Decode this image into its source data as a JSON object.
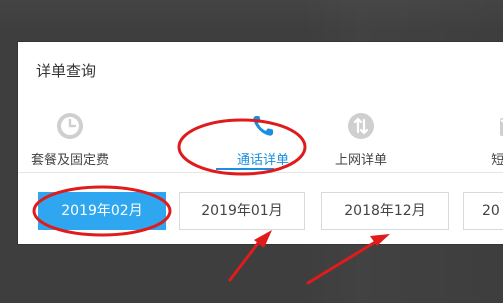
{
  "dialog": {
    "title": "详单查询"
  },
  "tabs": [
    {
      "label": "套餐及固定费",
      "icon": "clock-icon",
      "active": false
    },
    {
      "label": "通话详单",
      "icon": "phone-icon",
      "active": true
    },
    {
      "label": "上网详单",
      "icon": "data-transfer-icon",
      "active": false
    },
    {
      "label": "短信/彩",
      "icon": "envelope-icon",
      "active": false
    }
  ],
  "months": [
    {
      "label": "2019年02月",
      "active": true
    },
    {
      "label": "2019年01月",
      "active": false
    },
    {
      "label": "2018年12月",
      "active": false
    },
    {
      "label": "20",
      "active": false
    }
  ],
  "colors": {
    "accent": "#1a8fe0",
    "active_month_bg": "#2ea7f0",
    "annotation": "#e01b1b",
    "backdrop": "#3e3e3e",
    "icon_gray": "#cfcfcf"
  }
}
